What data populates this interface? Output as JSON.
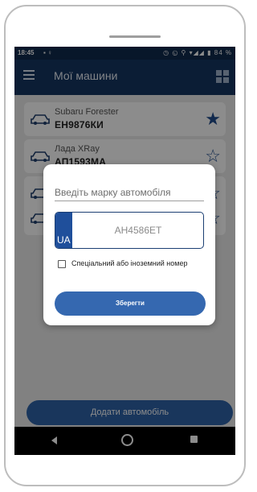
{
  "status_bar": {
    "time": "18:45",
    "left_icons": "▪ ♀",
    "right_icons": "◷ ◵ ⚲ ▾◢◢ ▮ 84 %"
  },
  "app_bar": {
    "title": "Мої машини",
    "menu_icon": "menu-icon",
    "action_icon": "grid-icon"
  },
  "cars": [
    {
      "brand": "Subaru Forester",
      "plate": "ЕН9876КИ",
      "favorite": true
    },
    {
      "brand": "Лада XRay",
      "plate": "АП1593МА",
      "favorite": false
    },
    {
      "brand": "",
      "plate": "",
      "favorite": false
    },
    {
      "brand": "",
      "plate": "",
      "favorite": false
    }
  ],
  "add_button_label": "Додати автомобіль",
  "dialog": {
    "brand_placeholder": "Введіть марку автомобіля",
    "country_code": "UA",
    "plate_placeholder": "АН4586ЕТ",
    "special_plate_label": "Спеціальний або іноземний номер",
    "special_plate_checked": false,
    "save_label": "Зберегти"
  },
  "colors": {
    "primary_dark": "#143562",
    "accent": "#3568b0",
    "star": "#1f4b8c"
  }
}
